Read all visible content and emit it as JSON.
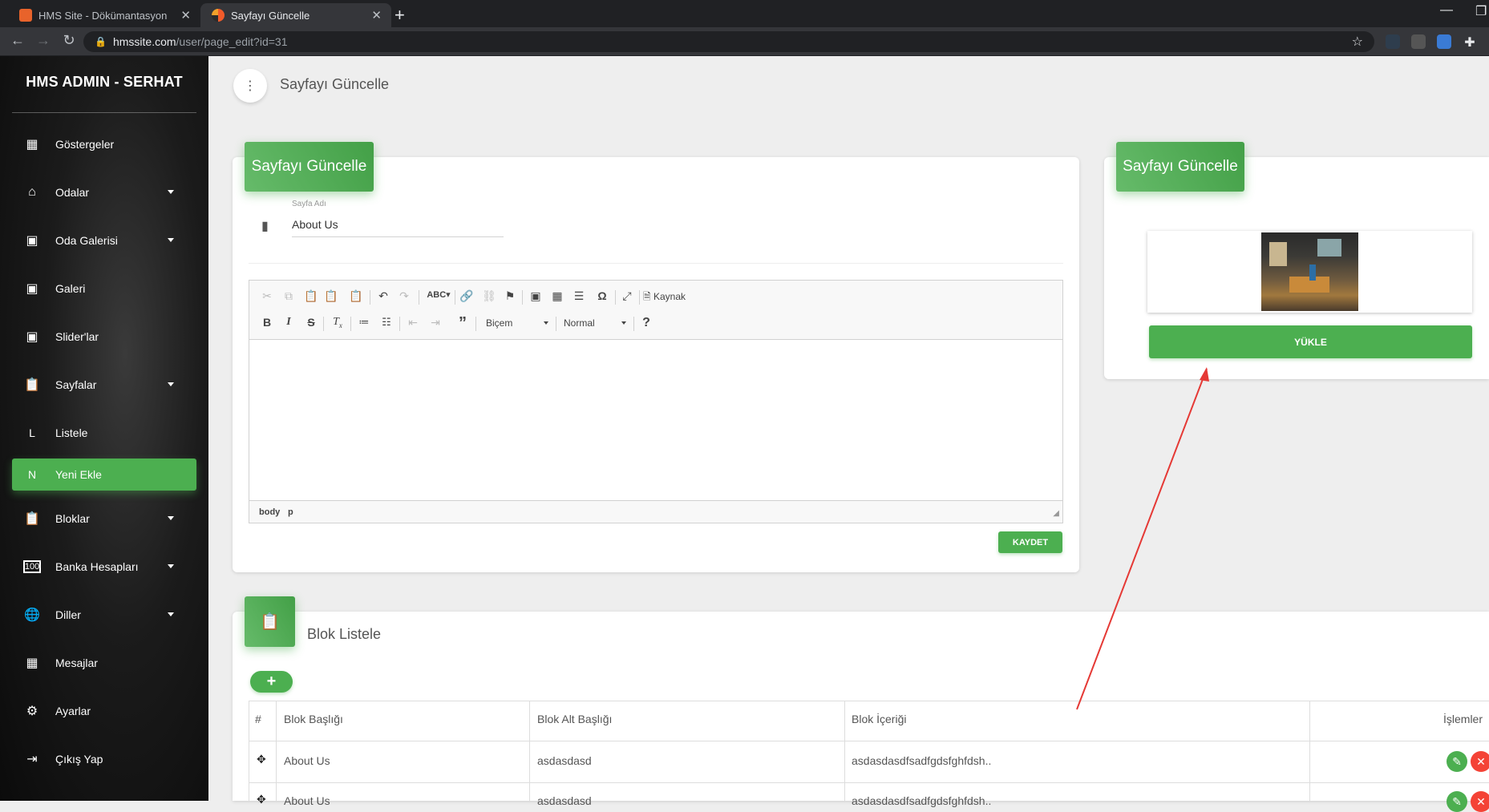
{
  "browser": {
    "tabs": [
      {
        "title": "HMS Site - Dökümantasyon",
        "favicon_color": "#e8632b"
      },
      {
        "title": "Sayfayı Güncelle",
        "favicon_color": "#f25b2a"
      }
    ],
    "url_domain": "hmssite.com",
    "url_path": "/user/page_edit?id=31"
  },
  "sidebar": {
    "brand": "HMS ADMIN - SERHAT",
    "items": [
      {
        "label": "Göstergeler",
        "icon": "dashboard-icon"
      },
      {
        "label": "Odalar",
        "icon": "home-icon"
      },
      {
        "label": "Oda Galerisi",
        "icon": "image-icon"
      },
      {
        "label": "Galeri",
        "icon": "image-icon"
      },
      {
        "label": "Slider'lar",
        "icon": "image-icon"
      },
      {
        "label": "Sayfalar",
        "icon": "clipboard-icon"
      },
      {
        "label": "Listele",
        "letter": "L"
      },
      {
        "label": "Yeni Ekle",
        "letter": "N"
      },
      {
        "label": "Bloklar",
        "icon": "clipboard-icon"
      },
      {
        "label": "Banka Hesapları",
        "icon": "bank-icon"
      },
      {
        "label": "Diller",
        "icon": "globe-icon"
      },
      {
        "label": "Mesajlar",
        "icon": "dashboard-icon"
      },
      {
        "label": "Ayarlar",
        "icon": "gear-icon"
      },
      {
        "label": "Çıkış Yap",
        "icon": "logout-icon"
      }
    ]
  },
  "header": {
    "title": "Sayfayı Güncelle"
  },
  "edit_card": {
    "title": "Sayfayı Güncelle",
    "field_label": "Sayfa Adı",
    "field_value": "About Us",
    "toolbar": {
      "source_label": "Kaynak",
      "format_label": "Biçem",
      "size_label": "Normal"
    },
    "status_path": [
      "body",
      "p"
    ],
    "save_label": "KAYDET"
  },
  "image_card": {
    "title": "Sayfayı Güncelle",
    "upload_label": "YÜKLE"
  },
  "block_list": {
    "title": "Blok Listele",
    "add_label": "+",
    "columns": [
      "#",
      "Blok Başlığı",
      "Blok Alt Başlığı",
      "Blok İçeriği",
      "İşlemler"
    ],
    "rows": [
      {
        "title": "About Us",
        "subtitle": "asdasdasd",
        "content": "asdasdasdfsadfgdsfghfdsh.."
      },
      {
        "title": "About Us",
        "subtitle": "asdasdasd",
        "content": "asdasdasdfsadfgdsfghfdsh.."
      }
    ]
  },
  "colors": {
    "accent": "#4caf50",
    "danger": "#f44336",
    "annotation": "#e53935"
  }
}
